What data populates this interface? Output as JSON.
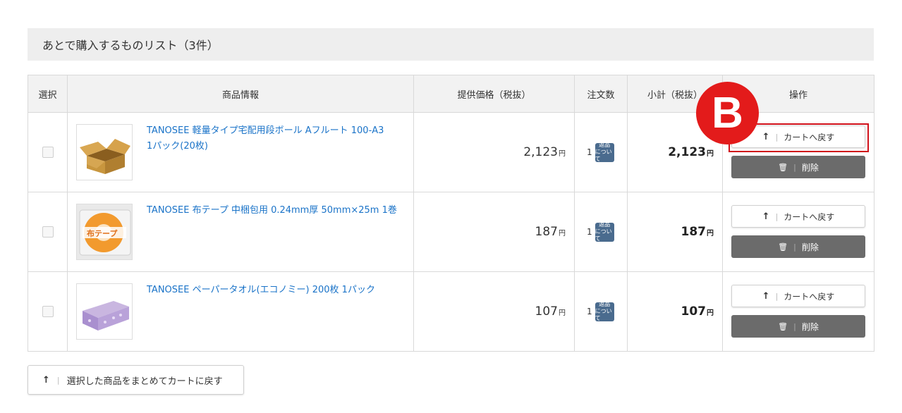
{
  "section_title": "あとで購入するものリスト（3件）",
  "columns": {
    "select": "選択",
    "info": "商品情報",
    "price": "提供価格（税抜）",
    "qty": "注文数",
    "subtotal": "小計（税抜）",
    "ops": "操作"
  },
  "yen_unit": "円",
  "return_badge": {
    "line1": "返品",
    "line2": "について"
  },
  "buttons": {
    "return_label": "カートへ戻す",
    "delete_label": "削除",
    "bulk_return_label": "選択した商品をまとめてカートに戻す",
    "separator": "|",
    "arrow": "↑",
    "trash": "🗑"
  },
  "marker": {
    "label": "B",
    "color": "#e31b1b"
  },
  "colors": {
    "link": "#1a73c8",
    "delete_button": "#6b6b6b",
    "highlight": "#d0101a",
    "header_bg": "#eeeeee"
  },
  "items": [
    {
      "name_line1": "TANOSEE 軽量タイプ宅配用段ボール Aフルート 100-A3",
      "name_line2": "1パック(20枚)",
      "image": "cardboard-box",
      "price": "2,123",
      "qty": "1",
      "subtotal": "2,123",
      "checked": false
    },
    {
      "name_line1": "TANOSEE 布テープ 中梱包用 0.24mm厚 50mm×25m 1巻",
      "name_line2": "",
      "image": "cloth-tape",
      "image_text": "布テープ",
      "price": "187",
      "qty": "1",
      "subtotal": "187",
      "checked": false
    },
    {
      "name_line1": "TANOSEE ペーパータオル(エコノミー) 200枚 1パック",
      "name_line2": "",
      "image": "paper-towel",
      "price": "107",
      "qty": "1",
      "subtotal": "107",
      "checked": false
    }
  ]
}
